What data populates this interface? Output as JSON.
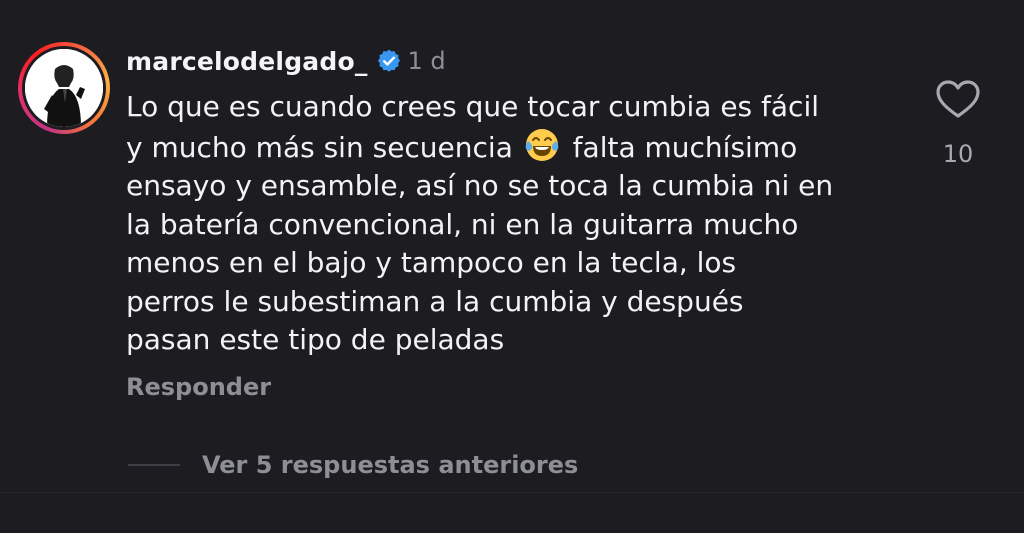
{
  "comment": {
    "username": "marcelodelgado_",
    "verified": true,
    "time": "1 d",
    "lines": [
      "Lo que es cuando crees que tocar cumbia es fácil",
      "y mucho más sin secuencia",
      "falta muchísimo",
      "ensayo y ensamble, así no se toca la cumbia ni en",
      "la batería convencional, ni en la guitarra mucho",
      "menos en el bajo y tampoco en la tecla, los",
      "perros le subestiman a la cumbia y después",
      "pasan este tipo de peladas"
    ],
    "emoji": "face-with-tears-of-joy",
    "reply_label": "Responder",
    "like_count": "10"
  },
  "replies": {
    "label": "Ver 5 respuestas anteriores"
  },
  "icons": {
    "like": "heart-outline-icon",
    "verified": "verified-badge-icon"
  },
  "colors": {
    "background": "#1c1c21",
    "text": "#f3f3f5",
    "muted": "#8e8e96",
    "verified": "#3897f0"
  }
}
